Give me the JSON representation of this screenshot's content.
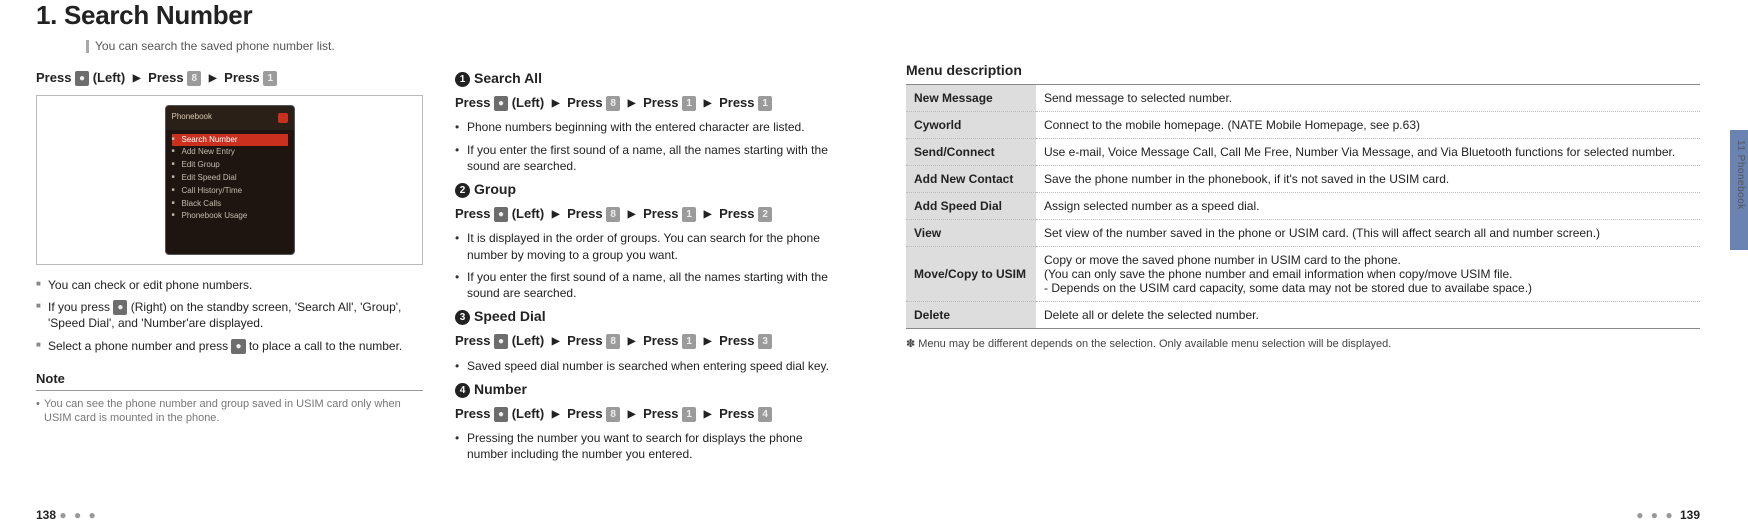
{
  "left": {
    "title": "1. Search Number",
    "subtitle": "You can search the saved phone number list.",
    "col1": {
      "press_prefix": "Press",
      "press_left": "(Left)",
      "press_word": "Press",
      "k1": "●",
      "k2": "8",
      "k3": "1",
      "shot_top": "Phonebook",
      "shot_items": [
        "Search Number",
        "Add New Entry",
        "Edit Group",
        "Edit Speed Dial",
        "Call History/Time",
        "Black Calls",
        "Phonebook Usage"
      ],
      "b1": "You can check or edit phone numbers.",
      "b2a": "If you press ",
      "b2_key": "●",
      "b2b": " (Right) on the standby screen, 'Search All', 'Group', 'Speed Dial', and 'Number'are displayed.",
      "b3a": "Select a phone number and press ",
      "b3_key": "●",
      "b3b": " to place a call to the number.",
      "note_head": "Note",
      "note_body": "You can see the phone number and group saved in USIM card only when USIM card is mounted in the phone."
    },
    "col2": {
      "items": [
        {
          "num": "1",
          "head": "Search All",
          "keys": [
            "●",
            "8",
            "1",
            "1"
          ],
          "bullets": [
            "Phone numbers beginning with the entered character are listed.",
            "If you enter the first sound of a name, all the names starting with the sound are searched."
          ]
        },
        {
          "num": "2",
          "head": "Group",
          "keys": [
            "●",
            "8",
            "1",
            "2"
          ],
          "bullets": [
            "It is displayed in the order of groups. You can search for the phone number by moving to a group you want.",
            "If you enter the first sound of a name, all the names starting with the sound are searched."
          ]
        },
        {
          "num": "3",
          "head": "Speed Dial",
          "keys": [
            "●",
            "8",
            "1",
            "3"
          ],
          "bullets": [
            "Saved speed dial number is searched when entering speed dial key."
          ]
        },
        {
          "num": "4",
          "head": "Number",
          "keys": [
            "●",
            "8",
            "1",
            "4"
          ],
          "bullets": [
            "Pressing the number you want to search for displays the phone number including the number you entered."
          ]
        }
      ],
      "press_prefix": "Press",
      "press_left": "(Left)",
      "press_word": "Press"
    },
    "page_num": "138"
  },
  "right": {
    "md_head": "Menu description",
    "rows": [
      {
        "h": "New Message",
        "d": "Send message to selected number."
      },
      {
        "h": "Cyworld",
        "d": "Connect to the mobile homepage. (NATE Mobile Homepage, see p.63)"
      },
      {
        "h": "Send/Connect",
        "d": "Use e-mail, Voice Message Call, Call Me Free, Number Via Message, and Via Bluetooth functions for selected number."
      },
      {
        "h": "Add New Contact",
        "d": "Save the phone number in the phonebook, if it's not saved in the USIM card."
      },
      {
        "h": "Add Speed Dial",
        "d": "Assign selected number as a speed dial."
      },
      {
        "h": "View",
        "d": "Set view of the number saved in the phone or USIM card. (This will affect search all and number screen.)"
      },
      {
        "h": "Move/Copy to USIM",
        "d": "Copy or move the saved phone number in USIM card to the phone.\n(You can only save the phone number and email information when copy/move USIM file.\n - Depends on the USIM card capacity, some data may not be stored due to availabe space.)"
      },
      {
        "h": "Delete",
        "d": "Delete all or delete the selected number."
      }
    ],
    "foot": "✽ Menu may be different depends on the selection. Only available menu selection will be displayed.",
    "side_label": "11 Phonebook",
    "page_num": "139"
  }
}
